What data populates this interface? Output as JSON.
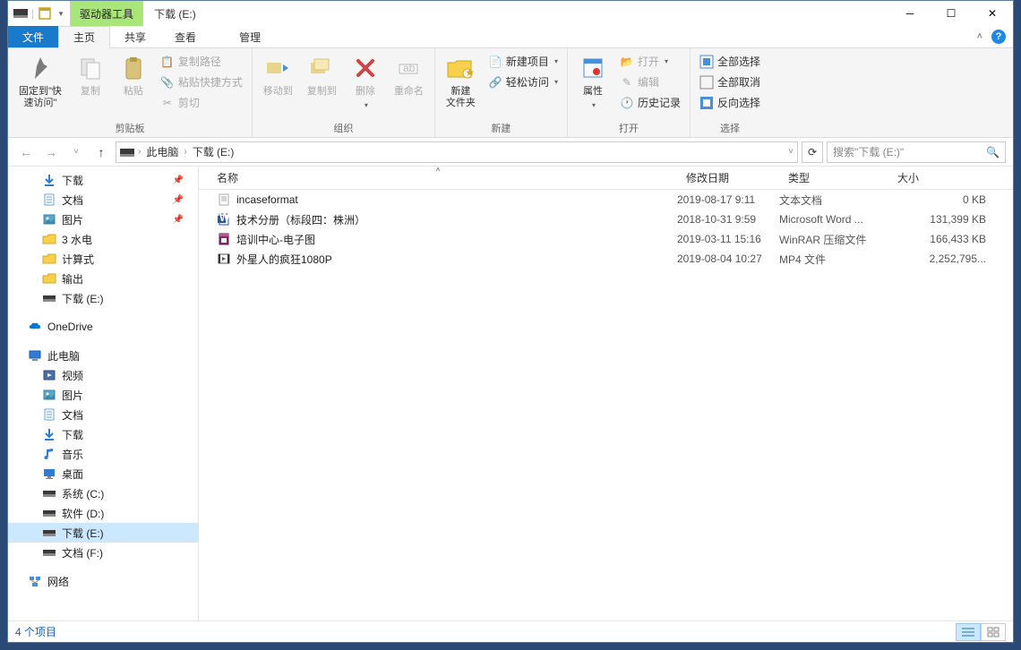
{
  "title_context_tab": "驱动器工具",
  "title_location": "下载 (E:)",
  "menu": {
    "file": "文件",
    "home": "主页",
    "share": "共享",
    "view": "查看",
    "manage": "管理"
  },
  "ribbon": {
    "pin": {
      "label": "固定到\"快\n速访问\""
    },
    "copy": "复制",
    "paste": "粘贴",
    "copy_path": "复制路径",
    "paste_shortcut": "粘贴快捷方式",
    "cut": "剪切",
    "group_clipboard": "剪贴板",
    "move_to": "移动到",
    "copy_to": "复制到",
    "delete": "删除",
    "rename": "重命名",
    "group_organize": "组织",
    "new_folder": "新建\n文件夹",
    "new_item": "新建项目",
    "easy_access": "轻松访问",
    "group_new": "新建",
    "properties": "属性",
    "open": "打开",
    "edit": "编辑",
    "history": "历史记录",
    "group_open": "打开",
    "select_all": "全部选择",
    "select_none": "全部取消",
    "invert_sel": "反向选择",
    "group_select": "选择"
  },
  "breadcrumbs": [
    "此电脑",
    "下载 (E:)"
  ],
  "search_placeholder": "搜索\"下载 (E:)\"",
  "nav": {
    "quick": [
      {
        "label": "下载",
        "pinned": true,
        "icon": "download"
      },
      {
        "label": "文档",
        "pinned": true,
        "icon": "doc"
      },
      {
        "label": "图片",
        "pinned": true,
        "icon": "pic"
      },
      {
        "label": "3 水电",
        "pinned": false,
        "icon": "folder"
      },
      {
        "label": "计算式",
        "pinned": false,
        "icon": "folder"
      },
      {
        "label": "输出",
        "pinned": false,
        "icon": "folder"
      },
      {
        "label": "下载 (E:)",
        "pinned": false,
        "icon": "drive"
      }
    ],
    "onedrive": "OneDrive",
    "thispc": "此电脑",
    "thispc_children": [
      {
        "label": "视频",
        "icon": "video"
      },
      {
        "label": "图片",
        "icon": "pic"
      },
      {
        "label": "文档",
        "icon": "doc"
      },
      {
        "label": "下载",
        "icon": "download"
      },
      {
        "label": "音乐",
        "icon": "music"
      },
      {
        "label": "桌面",
        "icon": "desktop"
      },
      {
        "label": "系统 (C:)",
        "icon": "drive"
      },
      {
        "label": "软件 (D:)",
        "icon": "drive"
      },
      {
        "label": "下载 (E:)",
        "icon": "drive",
        "selected": true
      },
      {
        "label": "文档 (F:)",
        "icon": "drive"
      }
    ],
    "network": "网络"
  },
  "columns": {
    "name": "名称",
    "date": "修改日期",
    "type": "类型",
    "size": "大小"
  },
  "files": [
    {
      "name": "incaseformat",
      "date": "2019-08-17 9:11",
      "type": "文本文档",
      "size": "0 KB",
      "icon": "txt"
    },
    {
      "name": "技术分册（标段四：株洲）",
      "date": "2018-10-31 9:59",
      "type": "Microsoft Word ...",
      "size": "131,399 KB",
      "icon": "word"
    },
    {
      "name": "培训中心-电子图",
      "date": "2019-03-11 15:16",
      "type": "WinRAR 压缩文件",
      "size": "166,433 KB",
      "icon": "rar"
    },
    {
      "name": "外星人的疯狂1080P",
      "date": "2019-08-04 10:27",
      "type": "MP4 文件",
      "size": "2,252,795...",
      "icon": "mp4"
    }
  ],
  "status": "4 个项目"
}
